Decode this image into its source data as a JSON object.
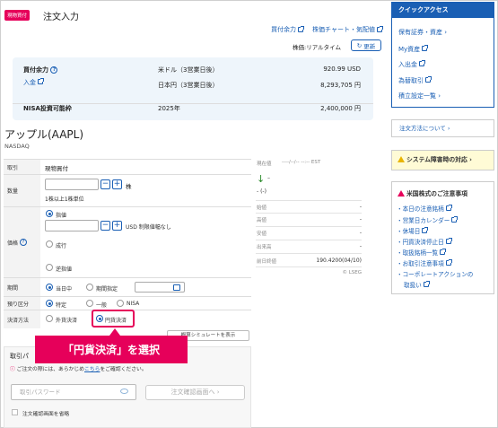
{
  "header": {
    "badge": "現物買付",
    "title": "注文入力",
    "links": [
      "買付余力",
      "株価チャート・気配値"
    ],
    "price_line": "株価:リアルタイム",
    "refresh": "更新"
  },
  "buying_power": {
    "label": "買付余力",
    "deposit": "入金",
    "rows": [
      {
        "currency": "米ドル（3営業日後）",
        "amount": "920.99 USD"
      },
      {
        "currency": "日本円（3営業日後）",
        "amount": "8,293,705 円"
      }
    ],
    "nisa_label": "NISA投資可能枠",
    "nisa_year": "2025年",
    "nisa_amount": "2,400,000 円"
  },
  "stock": {
    "name": "アップル(AAPL)",
    "exchange": "NASDAQ"
  },
  "form": {
    "trade_label": "取引",
    "trade_value": "現物買付",
    "qty_label": "数量",
    "qty_unit": "株",
    "qty_note": "1株以上1株単位",
    "price_label": "価格",
    "limit": "指値",
    "limit_note": "USD 制限値幅なし",
    "market": "成行",
    "stop": "逆指値",
    "period_label": "期間",
    "today": "当日中",
    "period_spec": "期間指定",
    "custody_label": "預り区分",
    "specific": "特定",
    "general": "一般",
    "nisa": "NISA",
    "settle_label": "決済方法",
    "foreign": "外貨決済",
    "yen": "円貨決済",
    "simulate": "概算シミュレートを表示"
  },
  "callout": "「円貨決済」を選択",
  "password": {
    "title": "取引パ",
    "note_prefix": "ご注文の際には、あらかじめ",
    "note_link": "こちら",
    "note_suffix": "をご確認ください。",
    "placeholder": "取引パスワード",
    "confirm": "注文確認画面へ",
    "skip": "注文確認画面を省略"
  },
  "quote": {
    "now_label": "現在値",
    "now_time": "----/--/-- --:-- EST",
    "change": "- (-)",
    "rows": [
      {
        "label": "始値",
        "value": "-"
      },
      {
        "label": "高値",
        "value": "-"
      },
      {
        "label": "安値",
        "value": "-"
      },
      {
        "label": "出来高",
        "value": "-"
      },
      {
        "label": "前日終値",
        "value": "190.4200(04/10)"
      }
    ],
    "source": "© LSEG"
  },
  "sidebar": {
    "quick_title": "クイックアクセス",
    "quick_items": [
      "保有証券・資産",
      "My資産",
      "入出金",
      "為替取引",
      "積立設定一覧"
    ],
    "order_method": "注文方法について",
    "system": "システム障害時の対応",
    "notice_title": "米国株式のご注意事項",
    "notice_items": [
      "本日の注意銘柄",
      "営業日カレンダー",
      "休場日",
      "円貨決済停止日",
      "取扱銘柄一覧",
      "お取引注意事項",
      "コーポレートアクションの",
      "取扱い"
    ]
  },
  "colors": {
    "accent": "#e6005a",
    "link": "#1a5fb4"
  }
}
